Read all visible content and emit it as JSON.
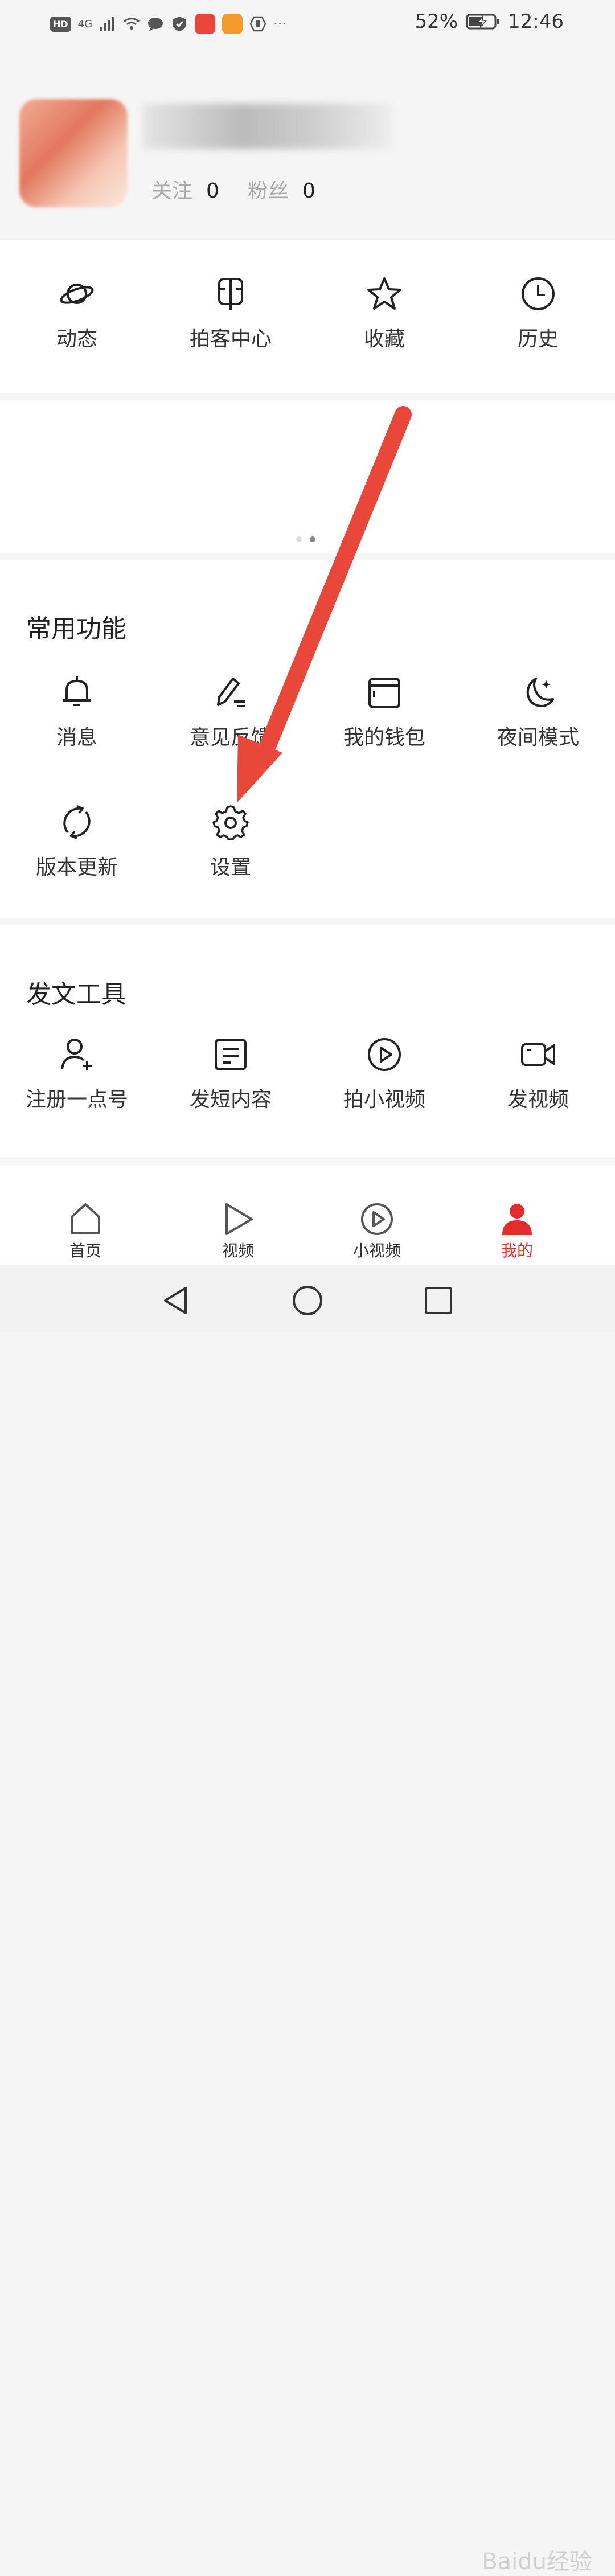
{
  "status_bar": {
    "hd": "HD",
    "network": "4G",
    "battery_percent": "52%",
    "time": "12:46",
    "more": "···"
  },
  "profile": {
    "following_label": "关注",
    "following_count": "0",
    "fans_label": "粉丝",
    "fans_count": "0"
  },
  "quick_actions": [
    {
      "label": "动态",
      "icon": "planet-icon"
    },
    {
      "label": "拍客中心",
      "icon": "monitor-icon"
    },
    {
      "label": "收藏",
      "icon": "star-icon"
    },
    {
      "label": "历史",
      "icon": "clock-icon"
    }
  ],
  "banner": {
    "page_count": 2,
    "active_page": 2
  },
  "common_functions": {
    "title": "常用功能",
    "items": [
      {
        "label": "消息",
        "icon": "bell-icon"
      },
      {
        "label": "意见反馈",
        "icon": "edit-icon"
      },
      {
        "label": "我的钱包",
        "icon": "wallet-icon"
      },
      {
        "label": "夜间模式",
        "icon": "moon-icon"
      },
      {
        "label": "版本更新",
        "icon": "refresh-icon"
      },
      {
        "label": "设置",
        "icon": "gear-icon"
      }
    ]
  },
  "posting_tools": {
    "title": "发文工具",
    "items": [
      {
        "label": "注册一点号",
        "icon": "add-user-icon"
      },
      {
        "label": "发短内容",
        "icon": "note-icon"
      },
      {
        "label": "拍小视频",
        "icon": "play-circle-icon"
      },
      {
        "label": "发视频",
        "icon": "video-camera-icon"
      }
    ]
  },
  "tab_bar": {
    "items": [
      {
        "label": "首页",
        "icon": "home-icon",
        "active": false
      },
      {
        "label": "视频",
        "icon": "play-icon",
        "active": false
      },
      {
        "label": "小视频",
        "icon": "play-circle-icon",
        "active": false
      },
      {
        "label": "我的",
        "icon": "user-icon",
        "active": true
      }
    ]
  },
  "colors": {
    "accent": "#e52c2c",
    "annotation_arrow": "#e8473a"
  },
  "watermark": "Baidu经验"
}
